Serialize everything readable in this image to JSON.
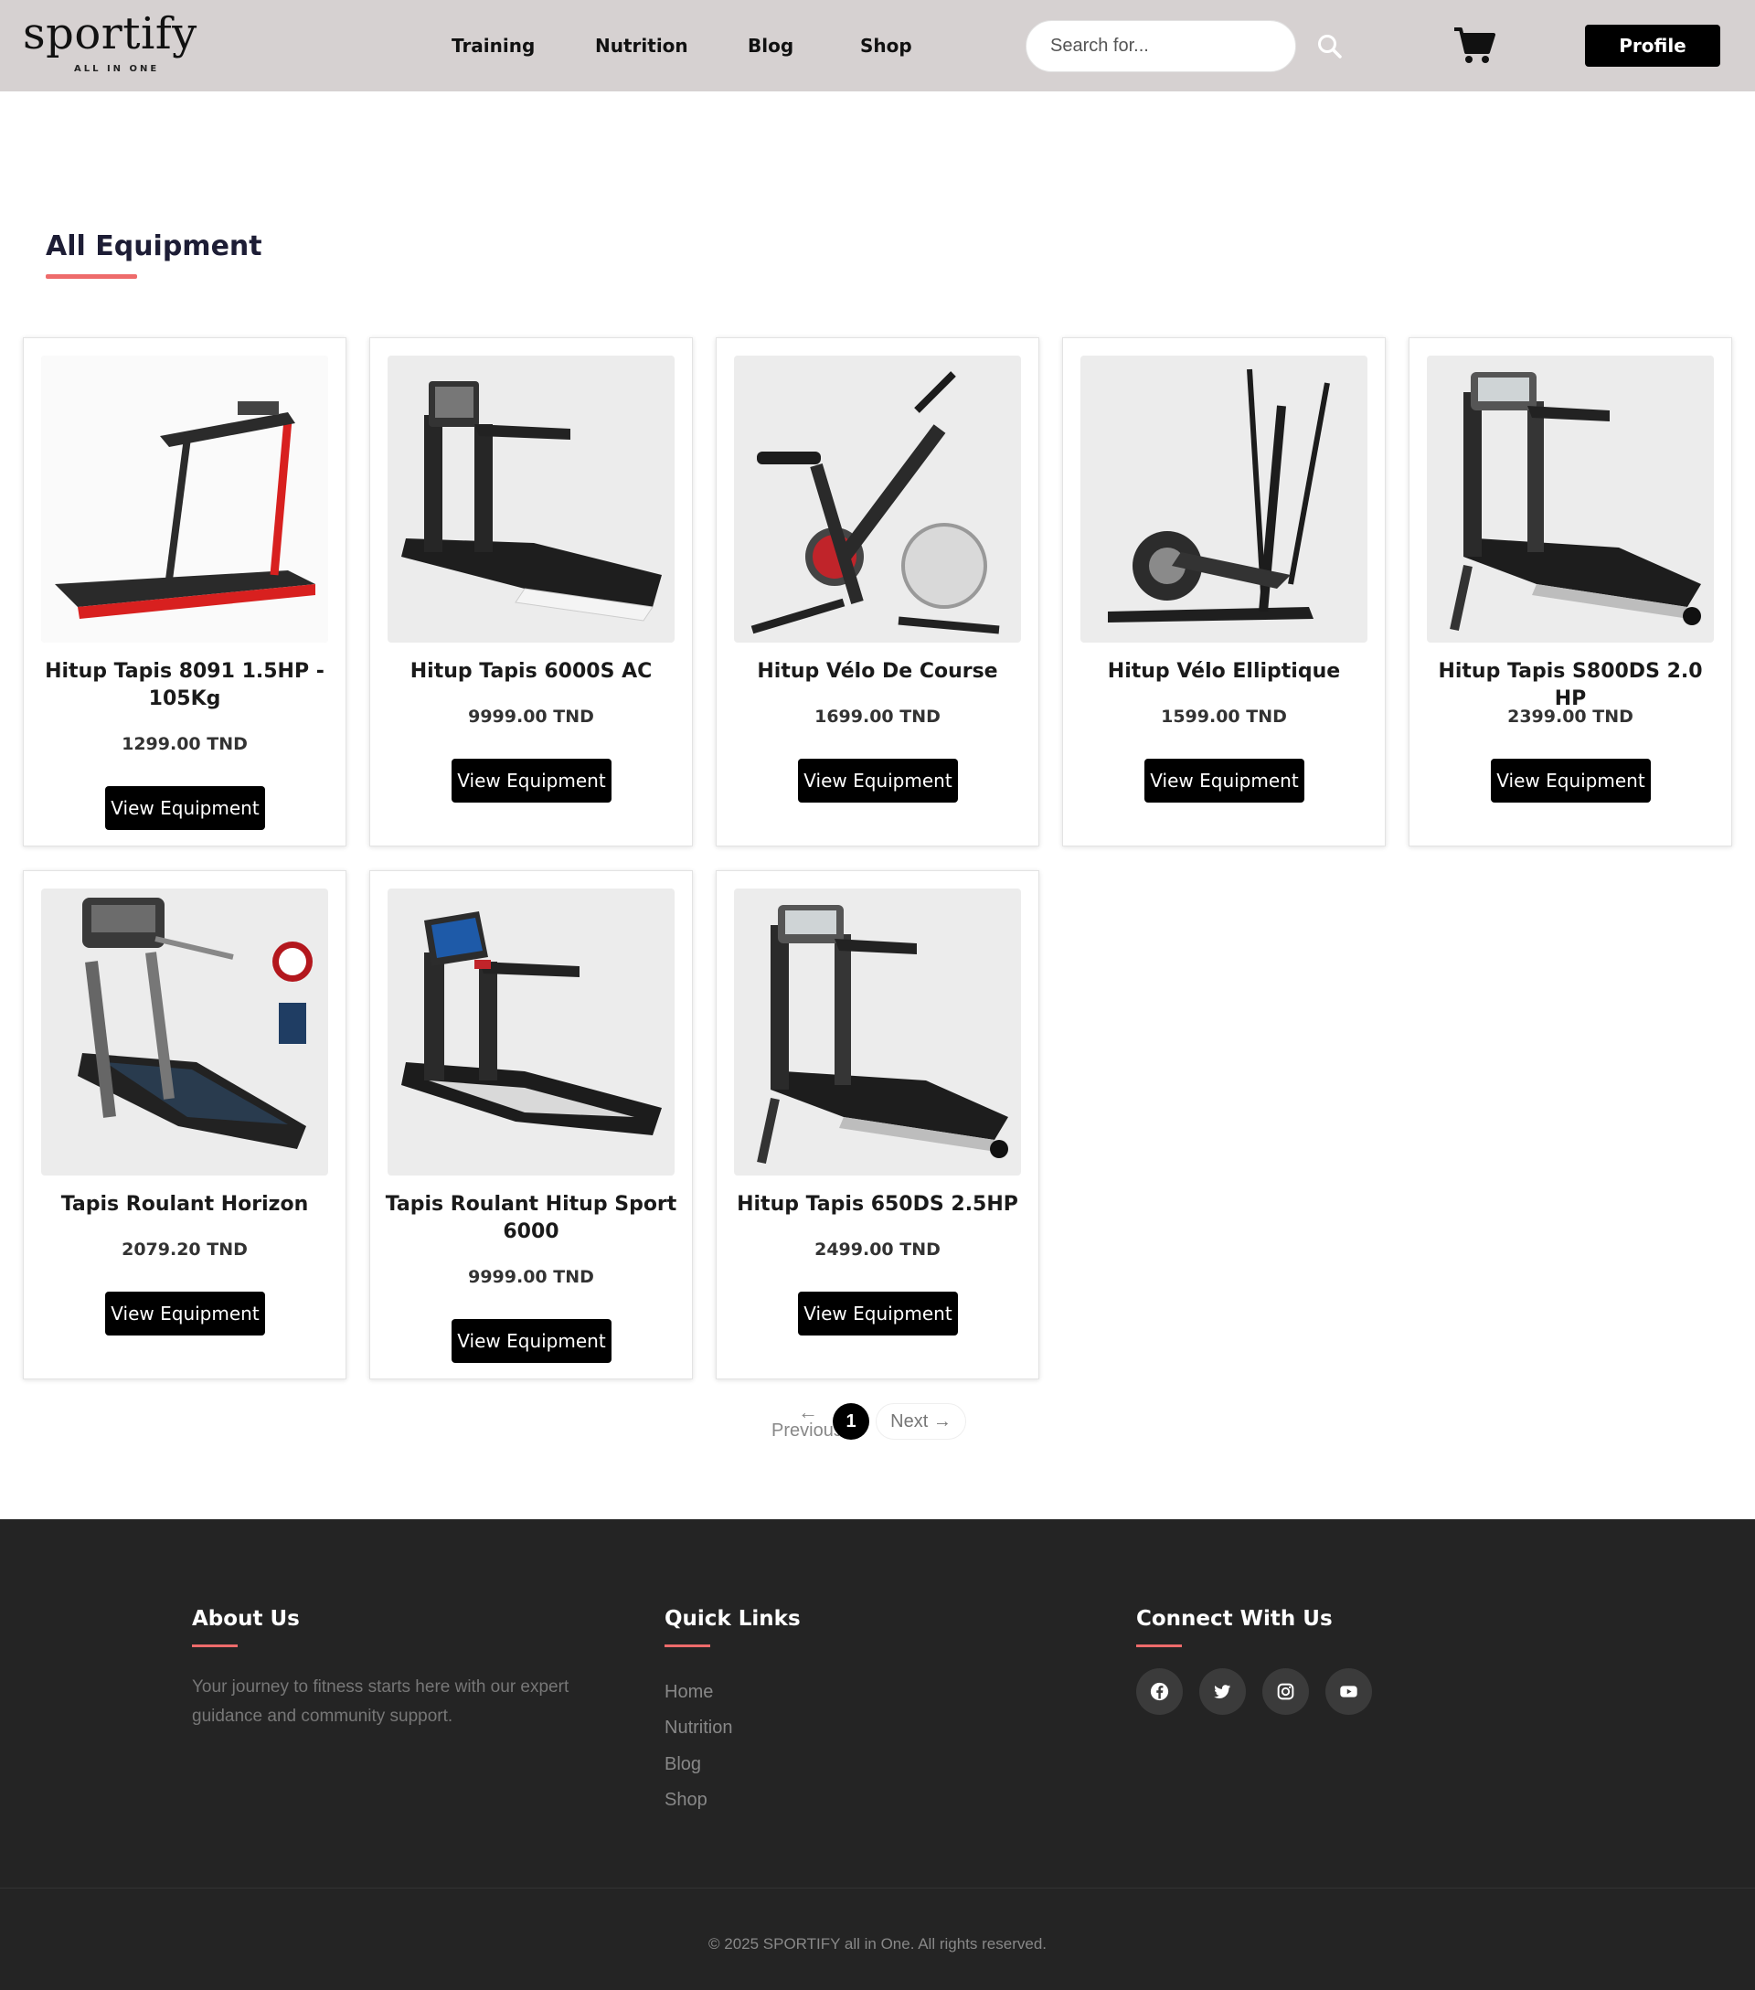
{
  "header": {
    "logo_text": "sportify",
    "logo_tagline": "ALL IN ONE",
    "nav": [
      "Training",
      "Nutrition",
      "Blog",
      "Shop"
    ],
    "search_placeholder": "Search for...",
    "profile_label": "Profile"
  },
  "main": {
    "section_title": "All Equipment",
    "products": [
      {
        "name": "Hitup Tapis 8091 1.5HP - 105Kg",
        "price": "1299.00 TND",
        "button": "View Equipment",
        "image": "treadmill-red"
      },
      {
        "name": "Hitup Tapis 6000S AC",
        "price": "9999.00 TND",
        "button": "View Equipment",
        "image": "treadmill-black"
      },
      {
        "name": "Hitup Vélo De Course",
        "price": "1699.00 TND",
        "button": "View Equipment",
        "image": "spin-bike"
      },
      {
        "name": "Hitup Vélo Elliptique",
        "price": "1599.00 TND",
        "button": "View Equipment",
        "image": "elliptical"
      },
      {
        "name": "Hitup Tapis S800DS 2.0 HP",
        "price": "2399.00 TND",
        "button": "View Equipment",
        "image": "treadmill-multi"
      },
      {
        "name": "Tapis Roulant Horizon",
        "price": "2079.20 TND",
        "button": "View Equipment",
        "image": "treadmill-horizon"
      },
      {
        "name": "Tapis Roulant Hitup Sport 6000",
        "price": "9999.00 TND",
        "button": "View Equipment",
        "image": "treadmill-screen"
      },
      {
        "name": "Hitup Tapis 650DS 2.5HP",
        "price": "2499.00 TND",
        "button": "View Equipment",
        "image": "treadmill-multi"
      }
    ],
    "pagination": {
      "previous": "Previous",
      "current": "1",
      "next": "Next →",
      "prev_arrow": "←"
    }
  },
  "footer": {
    "about_title": "About Us",
    "about_text": "Your journey to fitness starts here with our expert guidance and community support.",
    "links_title": "Quick Links",
    "links": [
      "Home",
      "Nutrition",
      "Blog",
      "Shop"
    ],
    "connect_title": "Connect With Us",
    "social_icons": [
      "facebook-icon",
      "twitter-icon",
      "instagram-icon",
      "youtube-icon"
    ],
    "copyright": "© 2025 SPORTIFY all in One. All rights reserved."
  },
  "colors": {
    "accent": "#ee6b6b",
    "nav_bg": "#d6d1d1",
    "footer_bg": "#242424",
    "button": "#000000"
  }
}
